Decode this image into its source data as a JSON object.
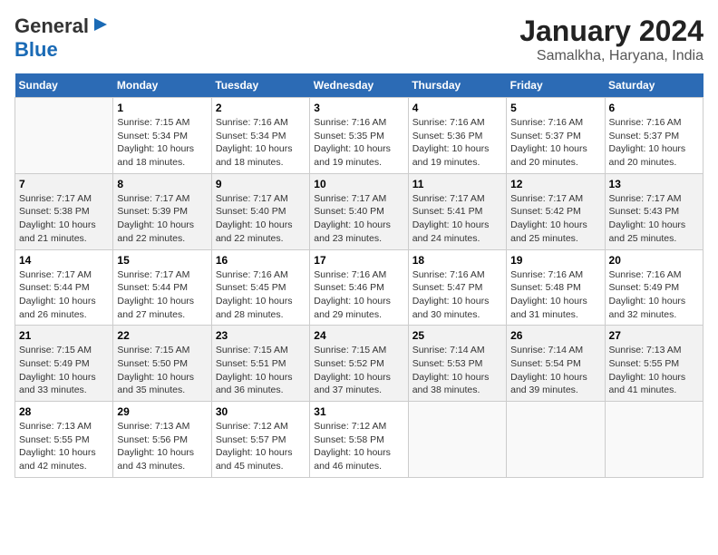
{
  "logo": {
    "line1": "General",
    "line2": "Blue"
  },
  "title": "January 2024",
  "subtitle": "Samalkha, Haryana, India",
  "weekdays": [
    "Sunday",
    "Monday",
    "Tuesday",
    "Wednesday",
    "Thursday",
    "Friday",
    "Saturday"
  ],
  "weeks": [
    [
      {
        "num": "",
        "info": ""
      },
      {
        "num": "1",
        "info": "Sunrise: 7:15 AM\nSunset: 5:34 PM\nDaylight: 10 hours\nand 18 minutes."
      },
      {
        "num": "2",
        "info": "Sunrise: 7:16 AM\nSunset: 5:34 PM\nDaylight: 10 hours\nand 18 minutes."
      },
      {
        "num": "3",
        "info": "Sunrise: 7:16 AM\nSunset: 5:35 PM\nDaylight: 10 hours\nand 19 minutes."
      },
      {
        "num": "4",
        "info": "Sunrise: 7:16 AM\nSunset: 5:36 PM\nDaylight: 10 hours\nand 19 minutes."
      },
      {
        "num": "5",
        "info": "Sunrise: 7:16 AM\nSunset: 5:37 PM\nDaylight: 10 hours\nand 20 minutes."
      },
      {
        "num": "6",
        "info": "Sunrise: 7:16 AM\nSunset: 5:37 PM\nDaylight: 10 hours\nand 20 minutes."
      }
    ],
    [
      {
        "num": "7",
        "info": "Sunrise: 7:17 AM\nSunset: 5:38 PM\nDaylight: 10 hours\nand 21 minutes."
      },
      {
        "num": "8",
        "info": "Sunrise: 7:17 AM\nSunset: 5:39 PM\nDaylight: 10 hours\nand 22 minutes."
      },
      {
        "num": "9",
        "info": "Sunrise: 7:17 AM\nSunset: 5:40 PM\nDaylight: 10 hours\nand 22 minutes."
      },
      {
        "num": "10",
        "info": "Sunrise: 7:17 AM\nSunset: 5:40 PM\nDaylight: 10 hours\nand 23 minutes."
      },
      {
        "num": "11",
        "info": "Sunrise: 7:17 AM\nSunset: 5:41 PM\nDaylight: 10 hours\nand 24 minutes."
      },
      {
        "num": "12",
        "info": "Sunrise: 7:17 AM\nSunset: 5:42 PM\nDaylight: 10 hours\nand 25 minutes."
      },
      {
        "num": "13",
        "info": "Sunrise: 7:17 AM\nSunset: 5:43 PM\nDaylight: 10 hours\nand 25 minutes."
      }
    ],
    [
      {
        "num": "14",
        "info": "Sunrise: 7:17 AM\nSunset: 5:44 PM\nDaylight: 10 hours\nand 26 minutes."
      },
      {
        "num": "15",
        "info": "Sunrise: 7:17 AM\nSunset: 5:44 PM\nDaylight: 10 hours\nand 27 minutes."
      },
      {
        "num": "16",
        "info": "Sunrise: 7:16 AM\nSunset: 5:45 PM\nDaylight: 10 hours\nand 28 minutes."
      },
      {
        "num": "17",
        "info": "Sunrise: 7:16 AM\nSunset: 5:46 PM\nDaylight: 10 hours\nand 29 minutes."
      },
      {
        "num": "18",
        "info": "Sunrise: 7:16 AM\nSunset: 5:47 PM\nDaylight: 10 hours\nand 30 minutes."
      },
      {
        "num": "19",
        "info": "Sunrise: 7:16 AM\nSunset: 5:48 PM\nDaylight: 10 hours\nand 31 minutes."
      },
      {
        "num": "20",
        "info": "Sunrise: 7:16 AM\nSunset: 5:49 PM\nDaylight: 10 hours\nand 32 minutes."
      }
    ],
    [
      {
        "num": "21",
        "info": "Sunrise: 7:15 AM\nSunset: 5:49 PM\nDaylight: 10 hours\nand 33 minutes."
      },
      {
        "num": "22",
        "info": "Sunrise: 7:15 AM\nSunset: 5:50 PM\nDaylight: 10 hours\nand 35 minutes."
      },
      {
        "num": "23",
        "info": "Sunrise: 7:15 AM\nSunset: 5:51 PM\nDaylight: 10 hours\nand 36 minutes."
      },
      {
        "num": "24",
        "info": "Sunrise: 7:15 AM\nSunset: 5:52 PM\nDaylight: 10 hours\nand 37 minutes."
      },
      {
        "num": "25",
        "info": "Sunrise: 7:14 AM\nSunset: 5:53 PM\nDaylight: 10 hours\nand 38 minutes."
      },
      {
        "num": "26",
        "info": "Sunrise: 7:14 AM\nSunset: 5:54 PM\nDaylight: 10 hours\nand 39 minutes."
      },
      {
        "num": "27",
        "info": "Sunrise: 7:13 AM\nSunset: 5:55 PM\nDaylight: 10 hours\nand 41 minutes."
      }
    ],
    [
      {
        "num": "28",
        "info": "Sunrise: 7:13 AM\nSunset: 5:55 PM\nDaylight: 10 hours\nand 42 minutes."
      },
      {
        "num": "29",
        "info": "Sunrise: 7:13 AM\nSunset: 5:56 PM\nDaylight: 10 hours\nand 43 minutes."
      },
      {
        "num": "30",
        "info": "Sunrise: 7:12 AM\nSunset: 5:57 PM\nDaylight: 10 hours\nand 45 minutes."
      },
      {
        "num": "31",
        "info": "Sunrise: 7:12 AM\nSunset: 5:58 PM\nDaylight: 10 hours\nand 46 minutes."
      },
      {
        "num": "",
        "info": ""
      },
      {
        "num": "",
        "info": ""
      },
      {
        "num": "",
        "info": ""
      }
    ]
  ]
}
